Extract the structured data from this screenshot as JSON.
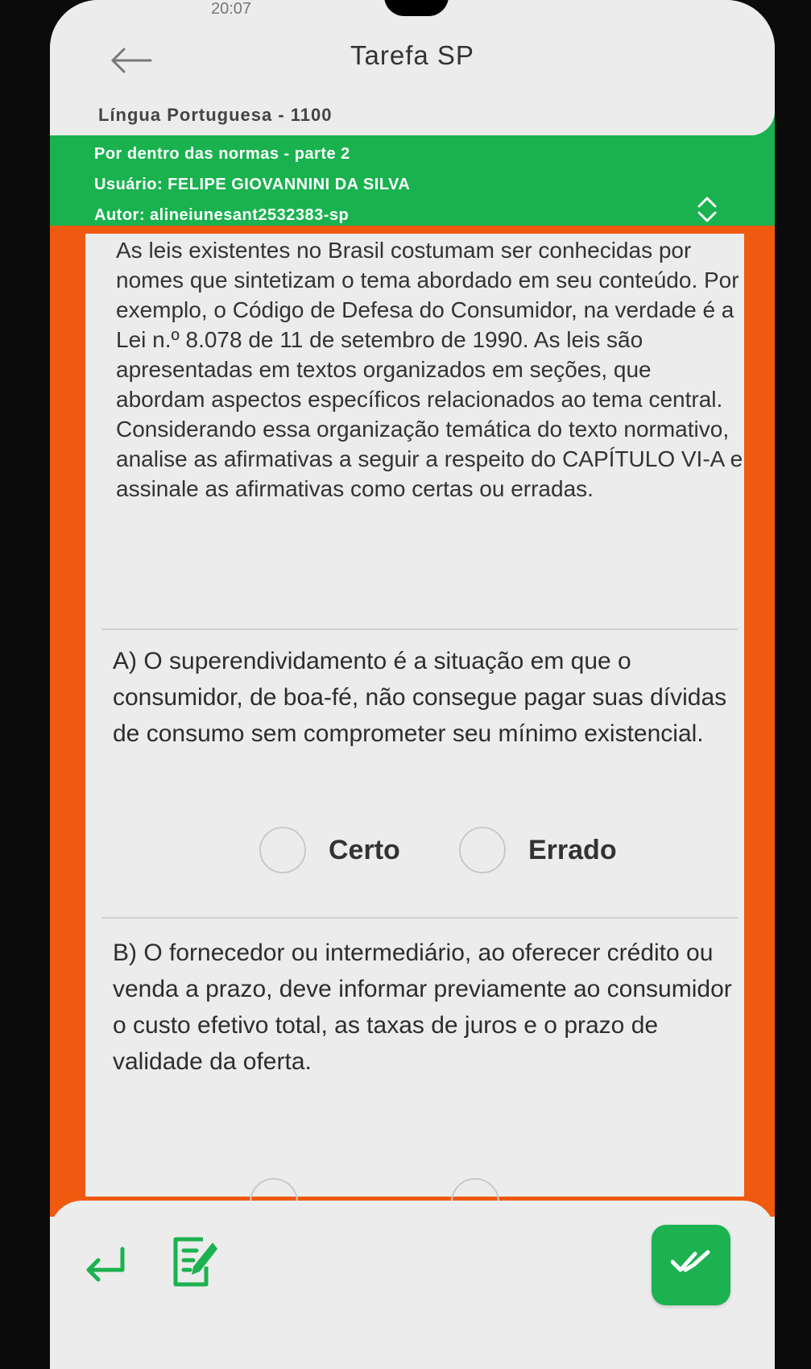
{
  "status_bar": {
    "time": "20:07"
  },
  "header": {
    "title": "Tarefa SP",
    "subject": "Língua Portuguesa - 1100"
  },
  "info": {
    "task_title": "Por dentro das normas - parte 2",
    "user": "Usuário: FELIPE GIOVANNINI DA SILVA",
    "author": "Autor: alineiunesant2532383-sp"
  },
  "statement": "As leis existentes no Brasil costumam ser conhecidas por nomes que sintetizam o tema abordado em seu conteúdo. Por exemplo, o Código de Defesa do Consumidor, na verdade é a Lei n.º 8.078 de 11 de setembro de 1990. As leis são apresentadas em textos organizados em seções, que abordam aspectos específicos relacionados ao tema central. Considerando essa organização temática do texto normativo, analise as afirmativas a seguir a respeito do CAPÍTULO VI-A e assinale as afirmativas como certas ou erradas.",
  "questions": [
    {
      "text": "A) O superendividamento é a situação em que o consumidor, de boa-fé, não consegue pagar suas dívidas de consumo sem comprometer seu mínimo existencial.",
      "options": [
        "Certo",
        "Errado"
      ]
    },
    {
      "text": "B) O fornecedor ou intermediário, ao oferecer crédito ou venda a prazo, deve informar previamente ao consumidor o custo efetivo total, as taxas de juros e o prazo de validade da oferta."
    }
  ],
  "colors": {
    "green": "#19b24f",
    "orange": "#f05a10",
    "card": "#ececec"
  },
  "icons": [
    "back-arrow-icon",
    "chevron-up-down-icon",
    "nav-back-icon",
    "edit-icon",
    "double-check-icon"
  ]
}
